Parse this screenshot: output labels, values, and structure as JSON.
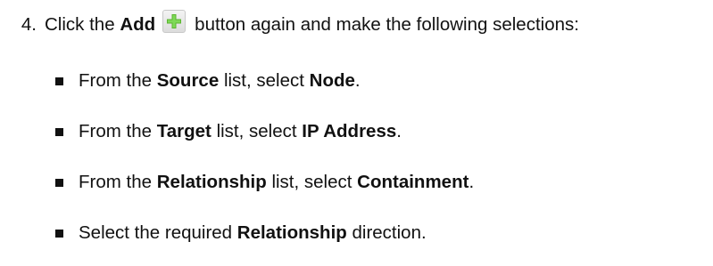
{
  "step": {
    "number": "4.",
    "intro_before": "Click the",
    "intro_button": "Add",
    "intro_after": "button again and make the following selections:",
    "add_icon": "green-plus-icon"
  },
  "bullets": [
    {
      "pre": "From the",
      "term": "Source",
      "mid": "list, select",
      "value": "Node",
      "end": "."
    },
    {
      "pre": "From the",
      "term": "Target",
      "mid": "list, select",
      "value": "IP Address",
      "end": "."
    },
    {
      "pre": "From the",
      "term": "Relationship",
      "mid": "list, select",
      "value": "Containment",
      "end": "."
    },
    {
      "pre": "Select the required",
      "term": "Relationship",
      "mid": "direction.",
      "value": "",
      "end": ""
    }
  ],
  "colors": {
    "text": "#111111",
    "icon_green": "#5cb531"
  }
}
